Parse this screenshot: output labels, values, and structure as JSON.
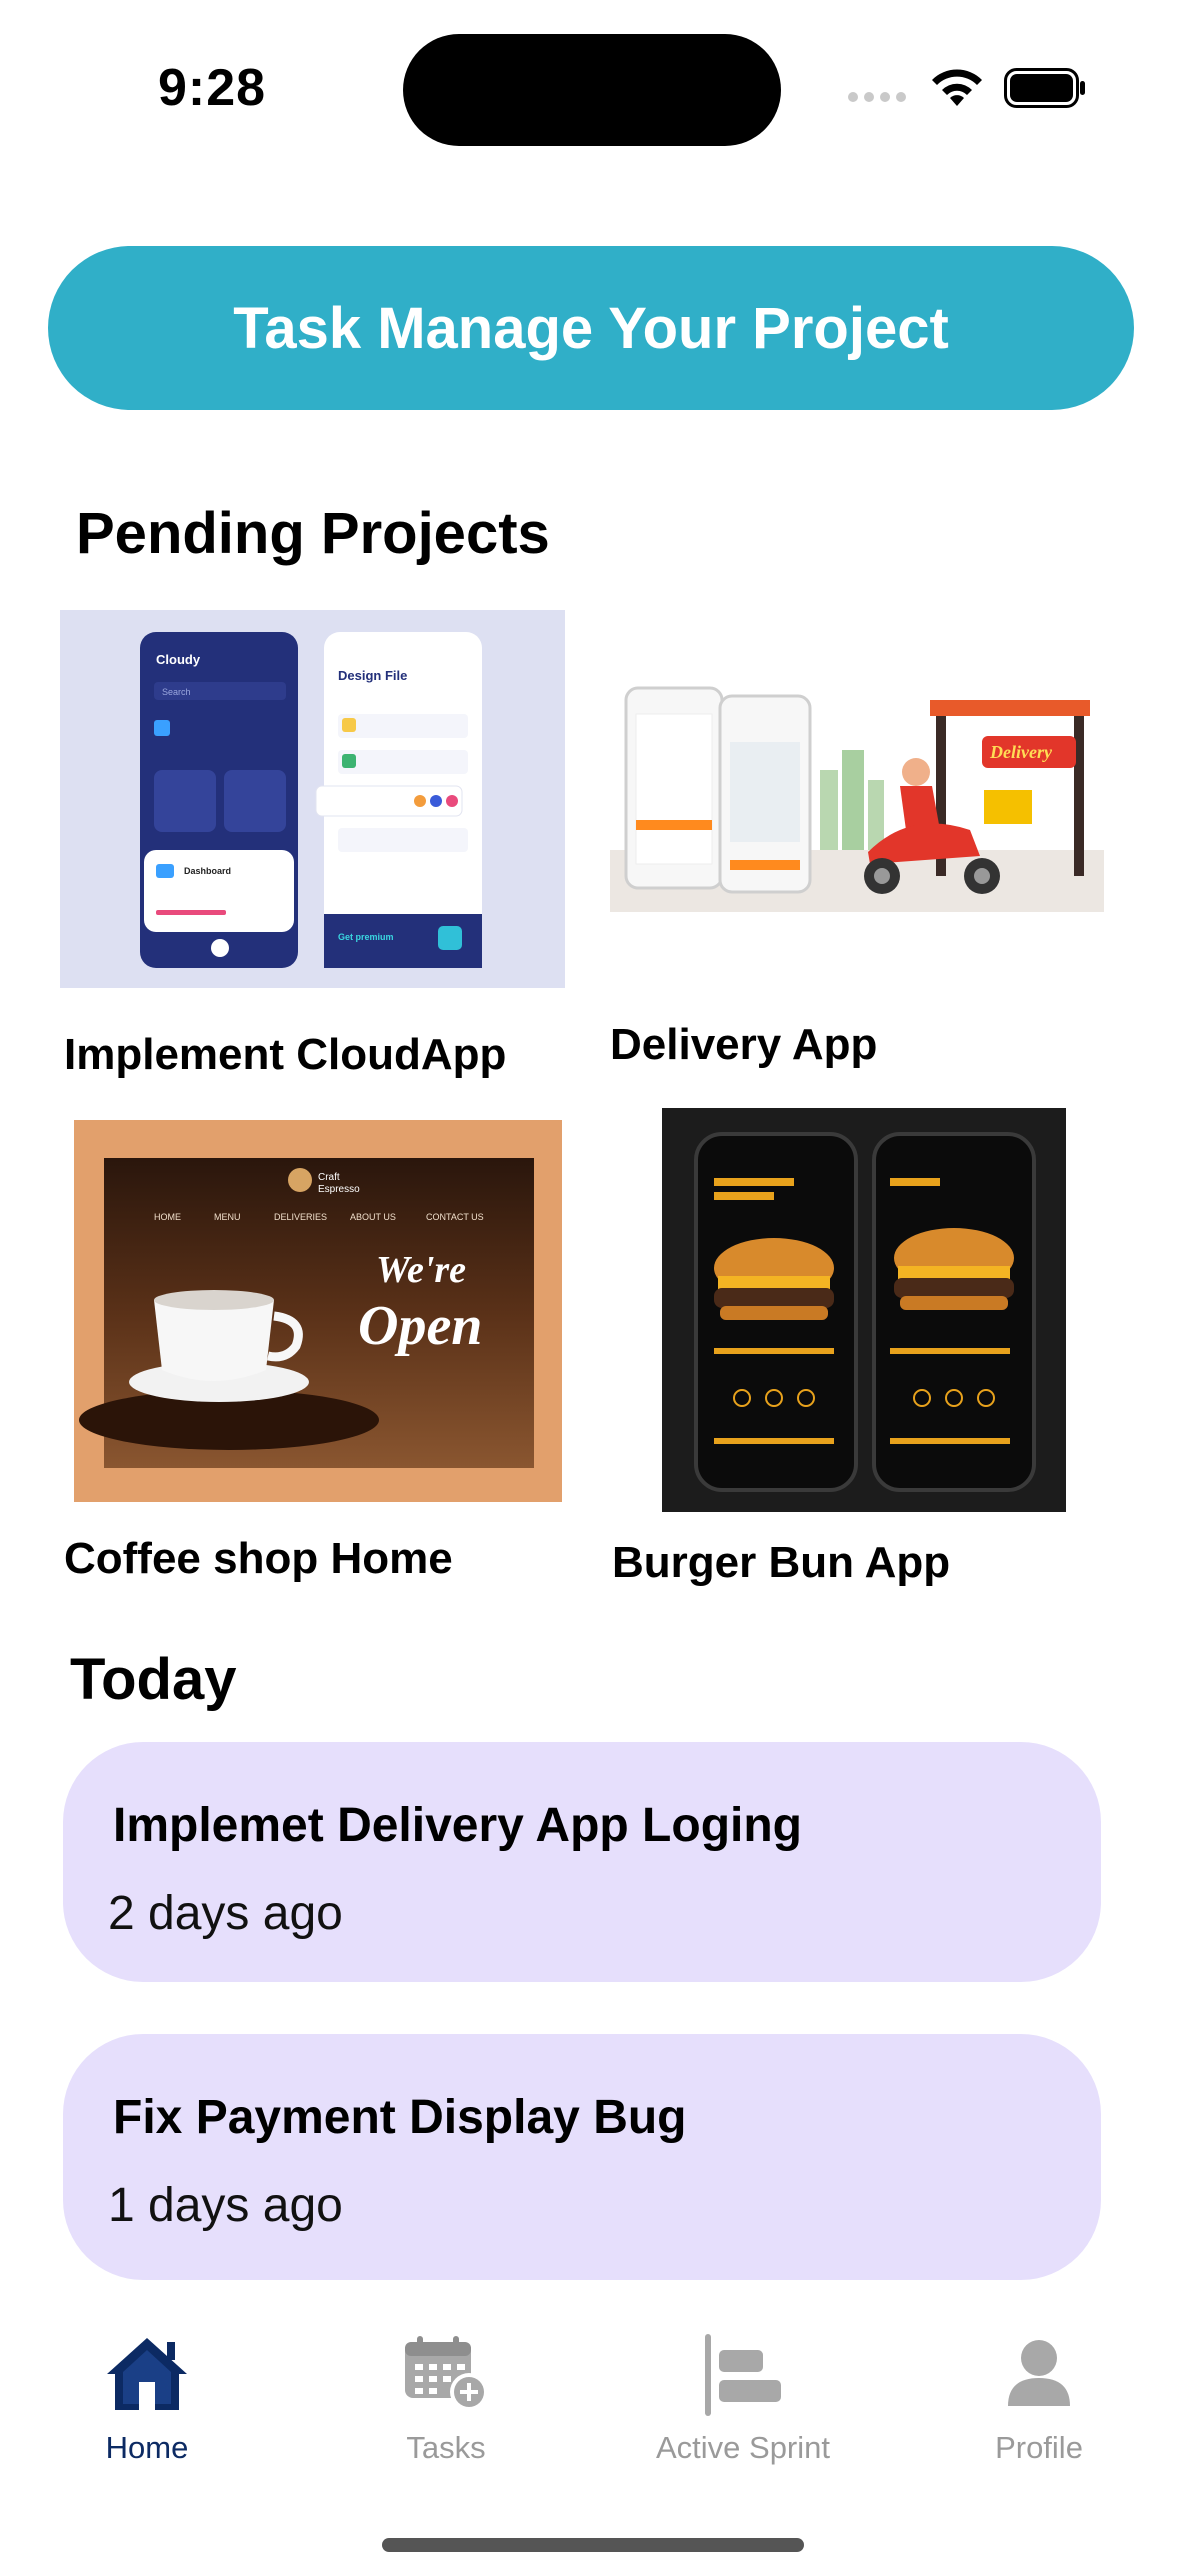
{
  "status": {
    "time": "9:28"
  },
  "banner": {
    "title": "Task Manage Your Project"
  },
  "pending": {
    "title": "Pending Projects",
    "projects": [
      {
        "label": "Implement CloudApp",
        "image_text": [
          "Cloudy",
          "Search",
          "Design File",
          "Dashboard",
          "Get premium"
        ]
      },
      {
        "label": "Delivery App",
        "image_text": [
          "Delivery"
        ]
      },
      {
        "label": "Coffee shop Home",
        "image_text": [
          "Craft",
          "Espresso",
          "HOME",
          "MENU",
          "DELIVERIES",
          "ABOUT US",
          "CONTACT US",
          "We're",
          "Open"
        ]
      },
      {
        "label": "Burger Bun App",
        "image_text": []
      }
    ]
  },
  "today": {
    "title": "Today",
    "tasks": [
      {
        "title": "Implemet Delivery App Loging",
        "time": "2 days ago"
      },
      {
        "title": "Fix Payment Display Bug",
        "time": "1 days ago"
      }
    ]
  },
  "tabs": [
    {
      "label": "Home",
      "icon": "home-icon",
      "active": true
    },
    {
      "label": "Tasks",
      "icon": "calendar-add-icon",
      "active": false
    },
    {
      "label": "Active Sprint",
      "icon": "sprint-bars-icon",
      "active": false
    },
    {
      "label": "Profile",
      "icon": "person-icon",
      "active": false
    }
  ],
  "colors": {
    "accent": "#30afc8",
    "card": "#e6dffc",
    "tab_active": "#0c2a63",
    "tab_inactive": "#9a9a9a"
  }
}
